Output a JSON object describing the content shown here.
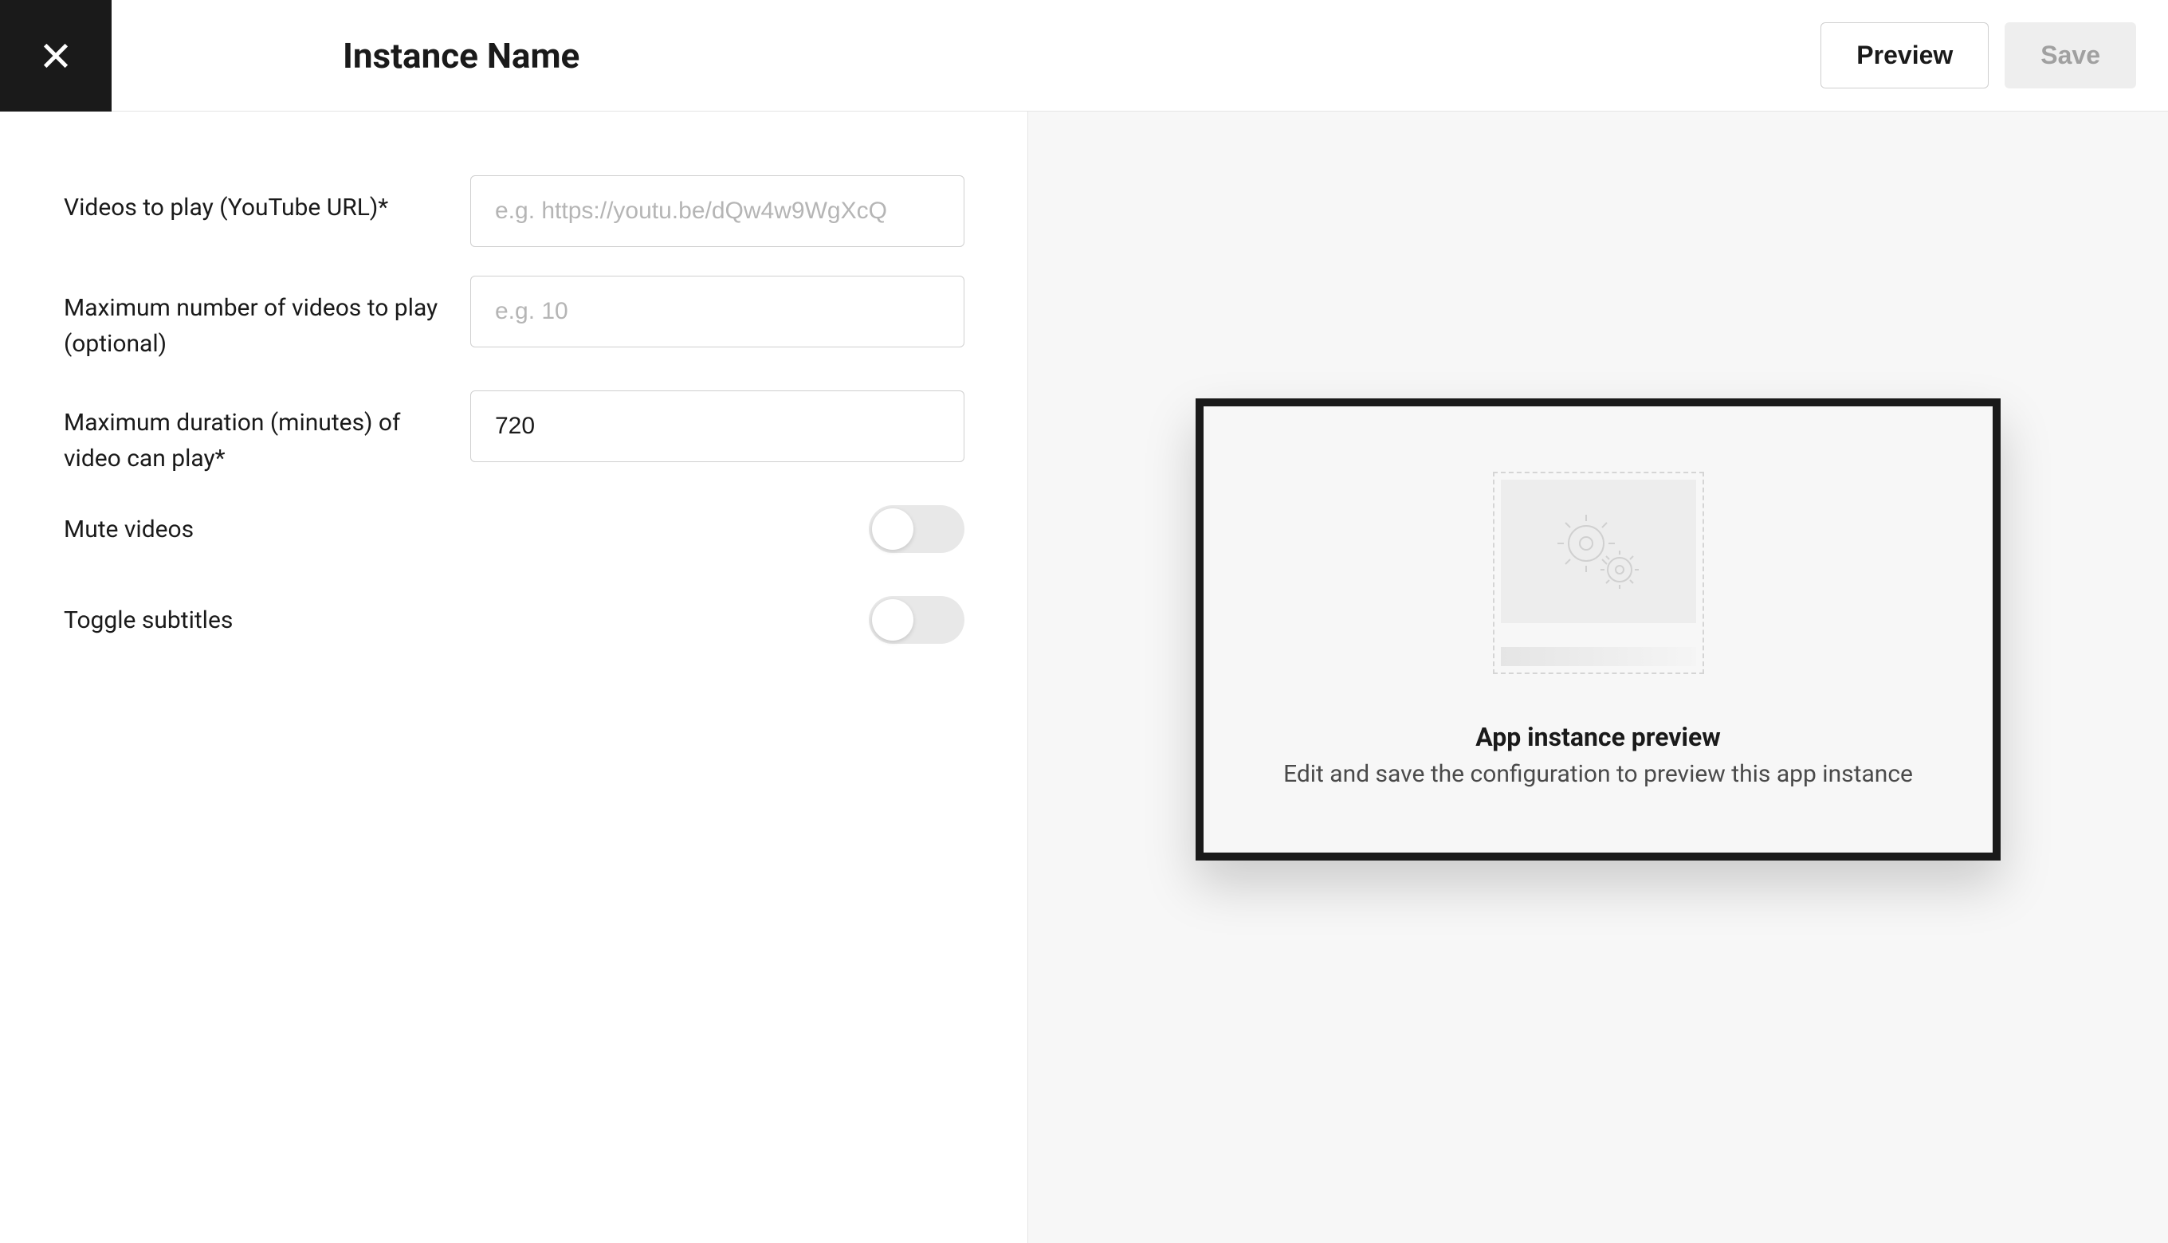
{
  "header": {
    "title": "Instance Name",
    "preview_label": "Preview",
    "save_label": "Save"
  },
  "form": {
    "videos_url": {
      "label": "Videos to play (YouTube URL)*",
      "placeholder": "e.g. https://youtu.be/dQw4w9WgXcQ",
      "value": ""
    },
    "max_videos": {
      "label": "Maximum number of videos to play (optional)",
      "placeholder": "e.g. 10",
      "value": ""
    },
    "max_duration": {
      "label": "Maximum duration (minutes) of video can play*",
      "value": "720"
    },
    "mute": {
      "label": "Mute videos",
      "value": false
    },
    "subtitles": {
      "label": "Toggle subtitles",
      "value": false
    }
  },
  "preview": {
    "title": "App instance preview",
    "subtitle": "Edit and save the configuration to preview this app instance"
  }
}
